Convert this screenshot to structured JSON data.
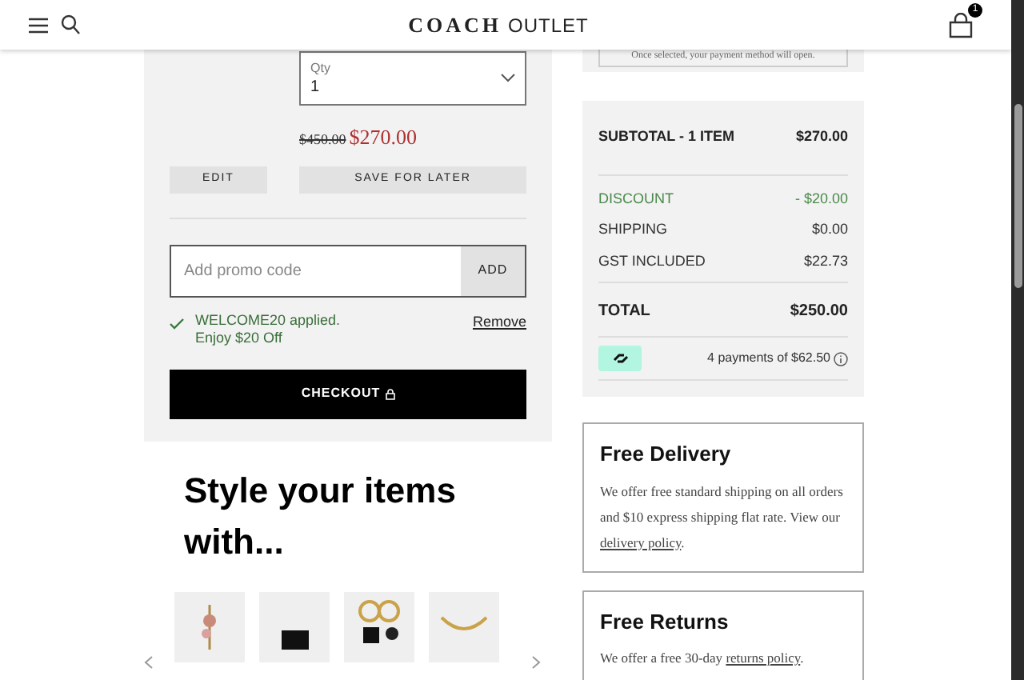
{
  "header": {
    "logo": "COACH",
    "logo_suffix": "OUTLET",
    "cart_count": "1"
  },
  "payment_note": "Once selected, your payment method will open.",
  "cart_item": {
    "qty_label": "Qty",
    "qty_value": "1",
    "original_price": "$450.00",
    "sale_price": "$270.00",
    "buttons": [
      "EDIT",
      "SAVE FOR LATER"
    ]
  },
  "promo": {
    "placeholder": "Add promo code",
    "button": "ADD",
    "applied": [
      "WELCOME20 applied.",
      "Enjoy $20 Off"
    ],
    "remove": "Remove"
  },
  "checkout": "CHECKOUT",
  "summary": {
    "subtotal": {
      "label": "SUBTOTAL - 1 ITEM",
      "value": "$270.00"
    },
    "lines": [
      {
        "label": "DISCOUNT",
        "value": "- $20.00",
        "kind": "discount"
      },
      {
        "label": "SHIPPING",
        "value": "$0.00",
        "kind": "normal"
      },
      {
        "label": "GST INCLUDED",
        "value": "$22.73",
        "kind": "normal"
      }
    ],
    "total": {
      "label": "TOTAL",
      "value": "$250.00"
    },
    "installments": "4 payments of $62.50"
  },
  "recommendations": {
    "title": "Style your items with...",
    "products": [
      {
        "kind": "charm"
      },
      {
        "kind": "bag"
      },
      {
        "kind": "keychain"
      },
      {
        "kind": "chain"
      }
    ]
  },
  "info_cards": [
    {
      "title": "Free Delivery",
      "text": "We offer free standard shipping on all orders and $10 express shipping flat rate. View our ",
      "link": "delivery policy",
      "after": "."
    },
    {
      "title": "Free Returns",
      "text": "We offer a free 30-day ",
      "link": "returns policy",
      "after": "."
    }
  ]
}
